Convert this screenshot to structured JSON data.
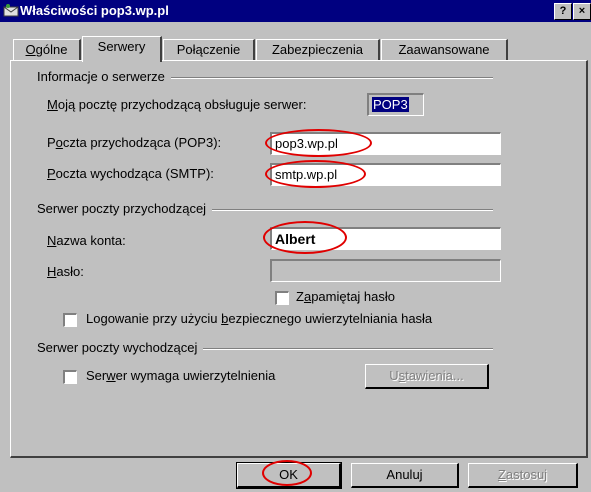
{
  "window": {
    "title": "Właściwości pop3.wp.pl",
    "help_button": "?",
    "close_button": "×"
  },
  "tabs": [
    {
      "label": "Ogólne",
      "accel": "O",
      "rest": "gólne",
      "active": false
    },
    {
      "label": "Serwery",
      "accel": "",
      "rest": "Serwery",
      "active": true
    },
    {
      "label": "Połączenie",
      "accel": "",
      "rest": "Połączenie",
      "active": false
    },
    {
      "label": "Zabezpieczenia",
      "accel": "",
      "rest": "Zabezpieczenia",
      "active": false
    },
    {
      "label": "Zaawansowane",
      "accel": "",
      "rest": "Zaawansowane",
      "active": false
    }
  ],
  "server_info": {
    "group_title": "Informacje o serwerze",
    "incoming_type_label_accel": "M",
    "incoming_type_label_rest": "oją pocztę przychodzącą obsługuje serwer:",
    "incoming_type_value": "POP3",
    "pop3_label_pre": "P",
    "pop3_label_accel": "o",
    "pop3_label_rest": "czta przychodząca (POP3):",
    "pop3_value": "pop3.wp.pl",
    "smtp_label_accel": "P",
    "smtp_label_rest": "oczta wychodząca (SMTP):",
    "smtp_value": "smtp.wp.pl"
  },
  "incoming_server": {
    "group_title": "Serwer poczty przychodzącej",
    "account_label_accel": "N",
    "account_label_rest": "azwa konta:",
    "account_value": "Albert",
    "password_label_accel": "H",
    "password_label_rest": "asło:",
    "password_value": "",
    "remember_pre": "Z",
    "remember_accel": "a",
    "remember_rest": "pamiętaj hasło",
    "remember_checked": false,
    "secure_pre": "Logowanie przy użyciu ",
    "secure_accel": "b",
    "secure_rest": "ezpiecznego uwierzytelniania hasła",
    "secure_checked": false
  },
  "outgoing_server": {
    "group_title": "Serwer poczty wychodzącej",
    "auth_pre": "Ser",
    "auth_accel": "w",
    "auth_rest": "er wymaga uwierzytelnienia",
    "auth_checked": false,
    "settings_pre": "U",
    "settings_accel": "s",
    "settings_rest": "tawienia..."
  },
  "buttons": {
    "ok": "OK",
    "cancel": "Anuluj",
    "apply_accel": "Z",
    "apply_rest": "astosuj"
  },
  "colors": {
    "titlebar": "#000080",
    "face": "#c0c0c0",
    "highlight_ring": "#e00000",
    "selection": "#000080"
  }
}
